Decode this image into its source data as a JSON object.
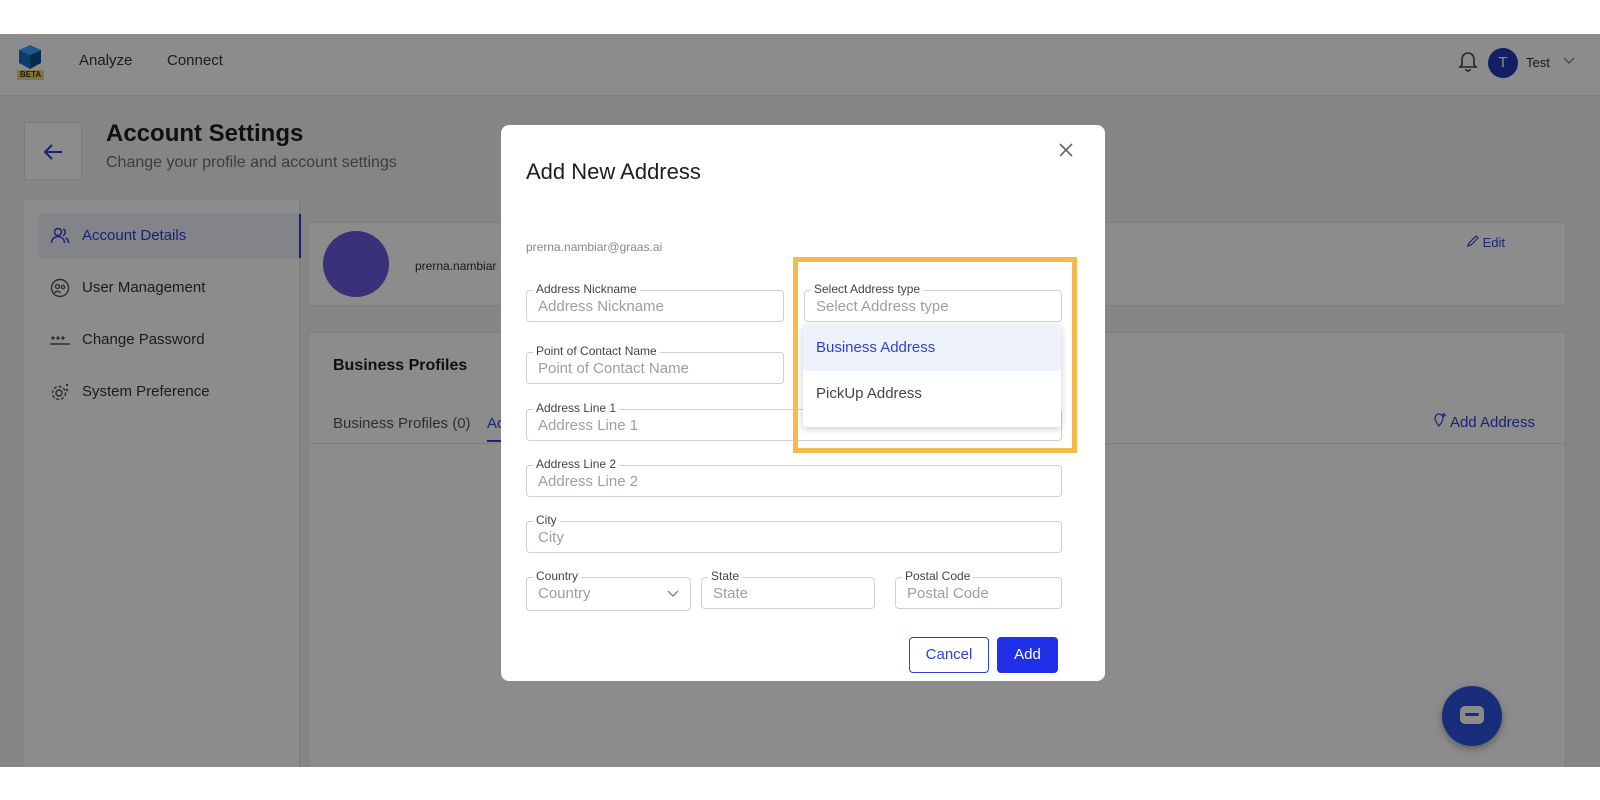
{
  "nav": {
    "logo_badge": "BETA",
    "links": [
      "Analyze",
      "Connect"
    ],
    "user_initial": "T",
    "user_name": "Test"
  },
  "page": {
    "title": "Account Settings",
    "subtitle": "Change your profile and account settings"
  },
  "sidebar": {
    "items": [
      {
        "label": "Account Details",
        "icon": "users-icon",
        "active": true
      },
      {
        "label": "User Management",
        "icon": "user-manage-icon",
        "active": false
      },
      {
        "label": "Change Password",
        "icon": "password-icon",
        "active": false
      },
      {
        "label": "System Preference",
        "icon": "gear-icon",
        "active": false
      }
    ]
  },
  "profile": {
    "email_truncated": "prerna.nambiar",
    "edit_label": "Edit"
  },
  "business_profiles": {
    "title": "Business Profiles",
    "tab_profiles": "Business Profiles (0)",
    "tab_second_truncated": "Ac",
    "add_address_label": "Add Address"
  },
  "modal": {
    "title": "Add New Address",
    "email": "prerna.nambiar@graas.ai",
    "fields": {
      "nickname": {
        "label": "Address Nickname",
        "placeholder": "Address Nickname"
      },
      "address_type": {
        "label": "Select Address type",
        "placeholder": "Select Address type"
      },
      "contact": {
        "label": "Point of Contact Name",
        "placeholder": "Point of Contact Name"
      },
      "line1": {
        "label": "Address Line 1",
        "placeholder": "Address Line 1"
      },
      "line2": {
        "label": "Address Line 2",
        "placeholder": "Address Line 2"
      },
      "city": {
        "label": "City",
        "placeholder": "City"
      },
      "country": {
        "label": "Country",
        "placeholder": "Country"
      },
      "state": {
        "label": "State",
        "placeholder": "State"
      },
      "postal": {
        "label": "Postal Code",
        "placeholder": "Postal Code"
      }
    },
    "cancel_label": "Cancel",
    "add_label": "Add"
  },
  "dropdown": {
    "options": [
      {
        "label": "Business Address",
        "selected": true
      },
      {
        "label": "PickUp Address",
        "selected": false
      }
    ]
  },
  "colors": {
    "accent": "#2f3fd8",
    "highlight": "#f6b94b",
    "avatar": "#1e3bb3"
  }
}
